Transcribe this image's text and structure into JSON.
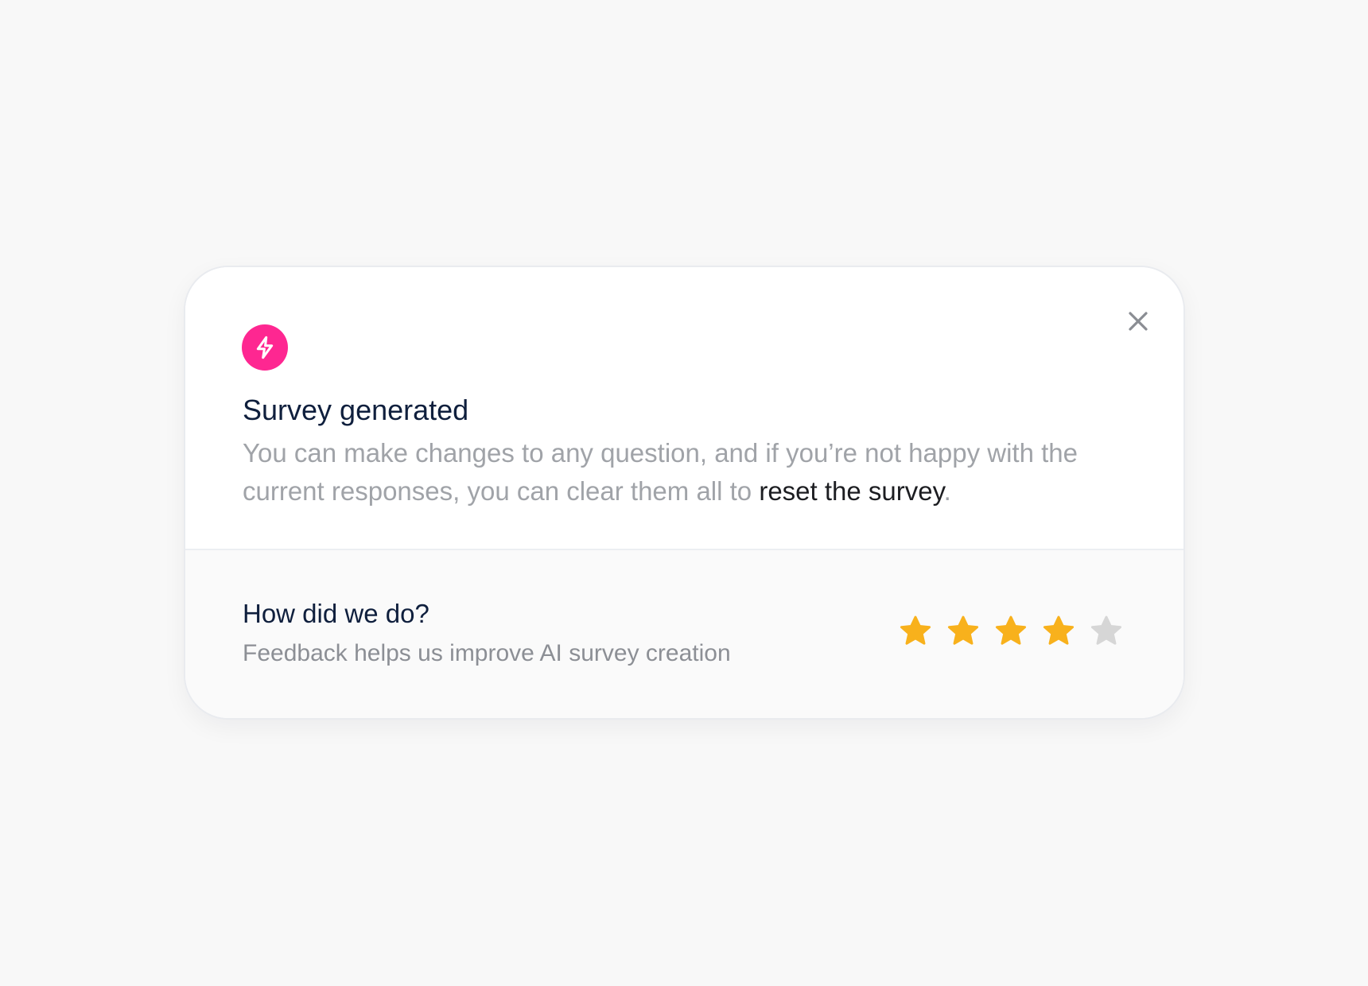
{
  "dialog": {
    "title": "Survey generated",
    "description_before_link": "You can make changes to any question, and if you’re not happy with the current responses, you can clear them all to ",
    "link_text": "reset the survey",
    "description_after_link": ".",
    "close_icon": "close-icon",
    "badge_icon": "lightning-bolt-icon"
  },
  "feedback": {
    "title": "How did we do?",
    "subtitle": "Feedback helps us improve AI survey creation",
    "rating": 4,
    "max_rating": 5
  },
  "colors": {
    "accent": "#fe2791",
    "star_filled": "#f8b11c",
    "star_empty": "#d6d6d6",
    "heading": "#0f1f3d"
  }
}
